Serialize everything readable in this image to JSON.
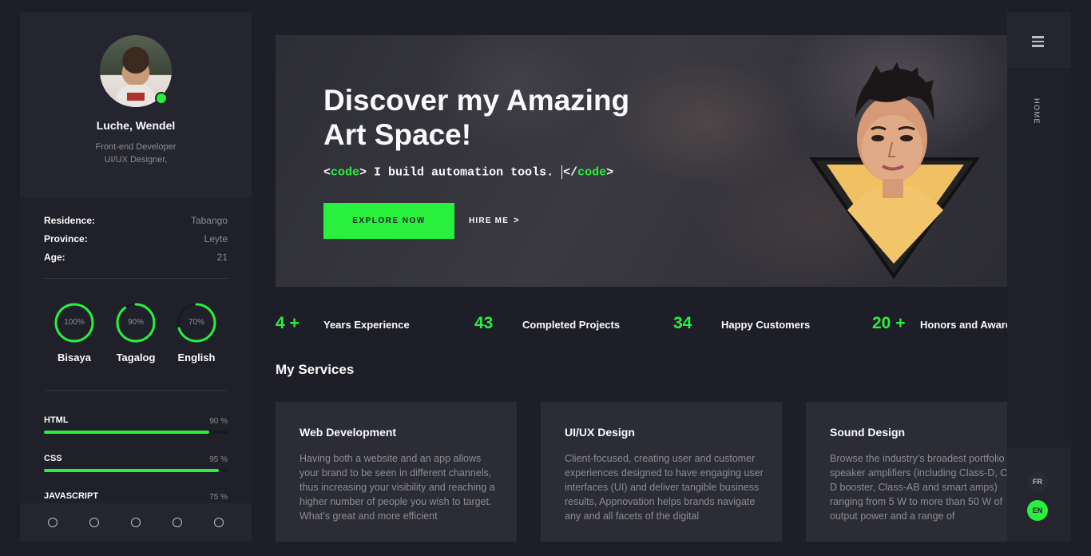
{
  "profile": {
    "name": "Luche, Wendel",
    "role_line1": "Front-end Developer",
    "role_line2": "UI/UX Designer,"
  },
  "info": [
    {
      "key": "Residence:",
      "value": "Tabango"
    },
    {
      "key": "Province:",
      "value": "Leyte"
    },
    {
      "key": "Age:",
      "value": "21"
    }
  ],
  "languages": [
    {
      "name": "Bisaya",
      "percent": "100%",
      "level": 1.0
    },
    {
      "name": "Tagalog",
      "percent": "90%",
      "level": 0.9
    },
    {
      "name": "English",
      "percent": "70%",
      "level": 0.7
    }
  ],
  "skills": [
    {
      "name": "HTML",
      "percent": "90 %",
      "level": 0.9
    },
    {
      "name": "CSS",
      "percent": "95 %",
      "level": 0.95
    },
    {
      "name": "JAVASCRIPT",
      "percent": "75 %",
      "level": 0.75
    }
  ],
  "hero": {
    "title_line1": "Discover my Amazing",
    "title_line2": "Art Space!",
    "code_open": "<",
    "code_tag": "code",
    "code_close": ">",
    "code_text": " I build automation tools. ",
    "code_end_open": "</",
    "code_end_tag": "code",
    "code_end_close": ">",
    "explore_label": "EXPLORE NOW",
    "hire_label": "HIRE ME",
    "hire_chevron": ">"
  },
  "counters": [
    {
      "number": "4 +",
      "label": "Years Experience"
    },
    {
      "number": "43",
      "label": "Completed Projects"
    },
    {
      "number": "34",
      "label": "Happy Customers"
    },
    {
      "number": "20 +",
      "label": "Honors and Awards"
    }
  ],
  "services": {
    "title": "My Services",
    "cards": [
      {
        "title": "Web Development",
        "text": "Having both a website and an app allows your brand to be seen in different channels, thus increasing your visibility and reaching a higher number of people you wish to target. What’s great and more efficient"
      },
      {
        "title": "UI/UX Design",
        "text": "Client-focused, creating user and customer experiences designed to have engaging user interfaces (UI) and deliver tangible business results, Appnovation helps brands navigate any and all facets of the digital"
      },
      {
        "title": "Sound Design",
        "text": "Browse the industry’s broadest portfolio of speaker amplifiers (including Class-D, Class-D booster, Class-AB and smart amps) ranging from 5 W to more than 50 W of output power and a range of"
      }
    ]
  },
  "rail": {
    "home_label": "HOME",
    "lang_fr": "FR",
    "lang_en": "EN"
  },
  "colors": {
    "accent": "#28f03c",
    "background": "#1e1e28",
    "panel": "#20202a",
    "card": "#2c2c37",
    "muted_text": "#8c8c8e"
  },
  "icons": {
    "menu": "hamburger-icon",
    "social": [
      "social-icon-1",
      "social-icon-2",
      "social-icon-3",
      "social-icon-4",
      "social-icon-5"
    ]
  }
}
